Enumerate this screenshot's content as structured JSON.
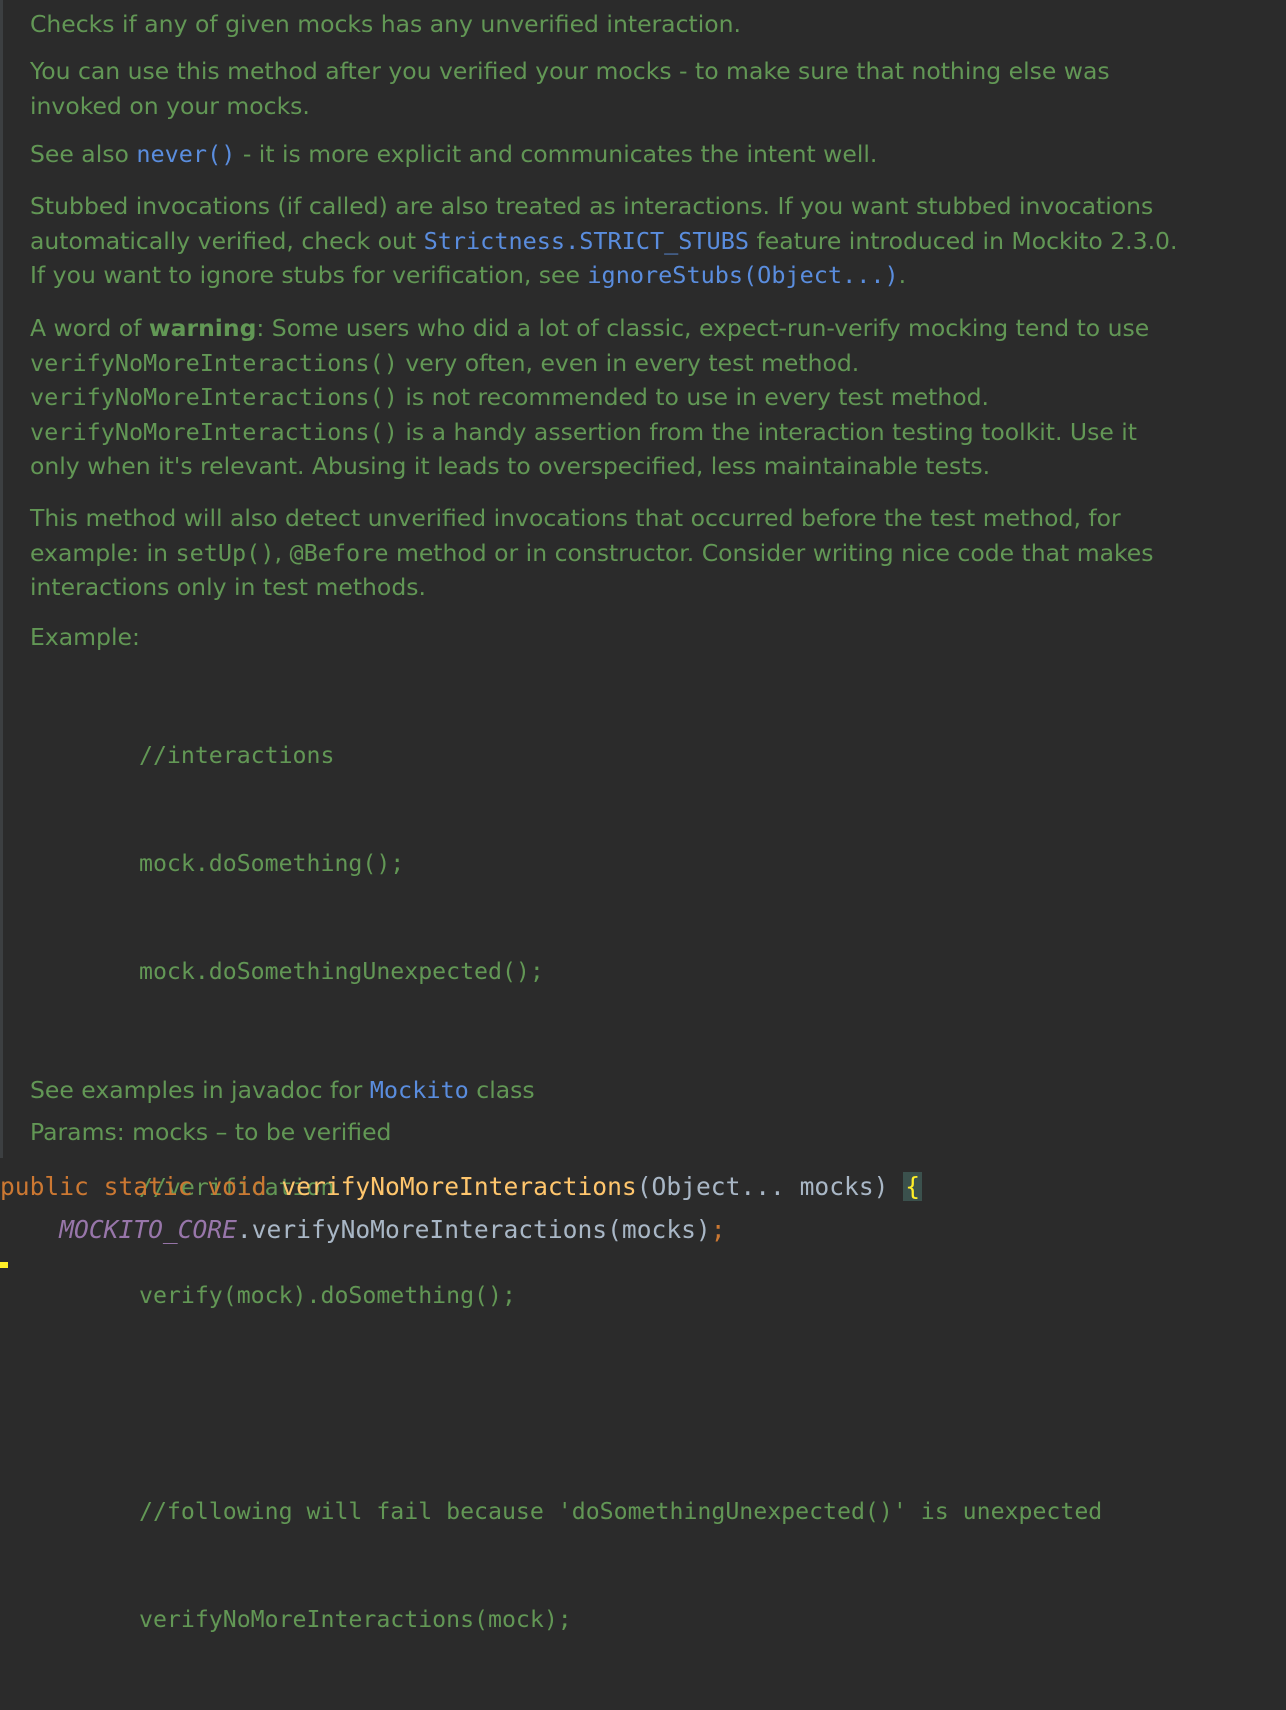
{
  "doc": {
    "p1": "Checks if any of given mocks has any unverified interaction.",
    "p2": {
      "l1": "You can use this method after you verified your mocks - to make sure that nothing else was",
      "l2": "invoked on your mocks."
    },
    "p3": {
      "pre": "See also ",
      "link": "never()",
      "post": " - it is more explicit and communicates the intent well."
    },
    "p4": {
      "l1": "Stubbed invocations (if called) are also treated as interactions. If you want stubbed invocations",
      "l2_pre": "automatically verified, check out ",
      "l2_link": "Strictness.STRICT_STUBS",
      "l2_post": " feature introduced in Mockito 2.3.0.",
      "l3_pre": "If you want to ignore stubs for verification, see ",
      "l3_link": "ignoreStubs(Object...)",
      "l3_post": "."
    },
    "p5": {
      "l1_pre": "A word of ",
      "l1_bold": "warning",
      "l1_post": ": Some users who did a lot of classic, expect-run-verify mocking tend to use",
      "l2_code": "verifyNoMoreInteractions()",
      "l2_text": " very often, even in every test method.",
      "l3_code": "verifyNoMoreInteractions()",
      "l3_text": " is not recommended to use in every test method.",
      "l4_code": "verifyNoMoreInteractions()",
      "l4_text": " is a handy assertion from the interaction testing toolkit. Use it",
      "l5": "only when it's relevant. Abusing it leads to overspecified, less maintainable tests."
    },
    "p6": {
      "l1": "This method will also detect unverified invocations that occurred before the test method, for",
      "l2_pre": "example: in ",
      "l2_code1": "setUp()",
      "l2_mid": ", ",
      "l2_code2": "@Before",
      "l2_post": " method or in constructor. Consider writing nice code that makes",
      "l3": "interactions only in test methods."
    },
    "example_label": "Example:",
    "code": [
      "//interactions",
      "mock.doSomething();",
      "mock.doSomethingUnexpected();",
      "",
      "//verification",
      "verify(mock).doSomething();",
      "",
      "//following will fail because 'doSomethingUnexpected()' is unexpected",
      "verifyNoMoreInteractions(mock);"
    ],
    "see_examples": {
      "pre": "See examples in javadoc for ",
      "link": "Mockito",
      "post": " class"
    },
    "params": "Params: mocks – to be verified"
  },
  "source": {
    "line1": {
      "kw_public": "public",
      "kw_static": "static",
      "kw_void": "void",
      "method": "verifyNoMoreInteractions",
      "params": "(Object... mocks) ",
      "brace": "{"
    },
    "line2": {
      "indent": "    ",
      "const": "MOCKITO_CORE",
      "call": ".verifyNoMoreInteractions(mocks)",
      "semi": ";"
    }
  },
  "colors": {
    "background": "#2b2b2b",
    "doc_text": "#629755",
    "doc_link": "#5a8dde",
    "keyword": "#cc7832",
    "method": "#ffc66d",
    "constant": "#9876aa",
    "plain": "#a9b7c6",
    "brace": "#ffef28"
  }
}
